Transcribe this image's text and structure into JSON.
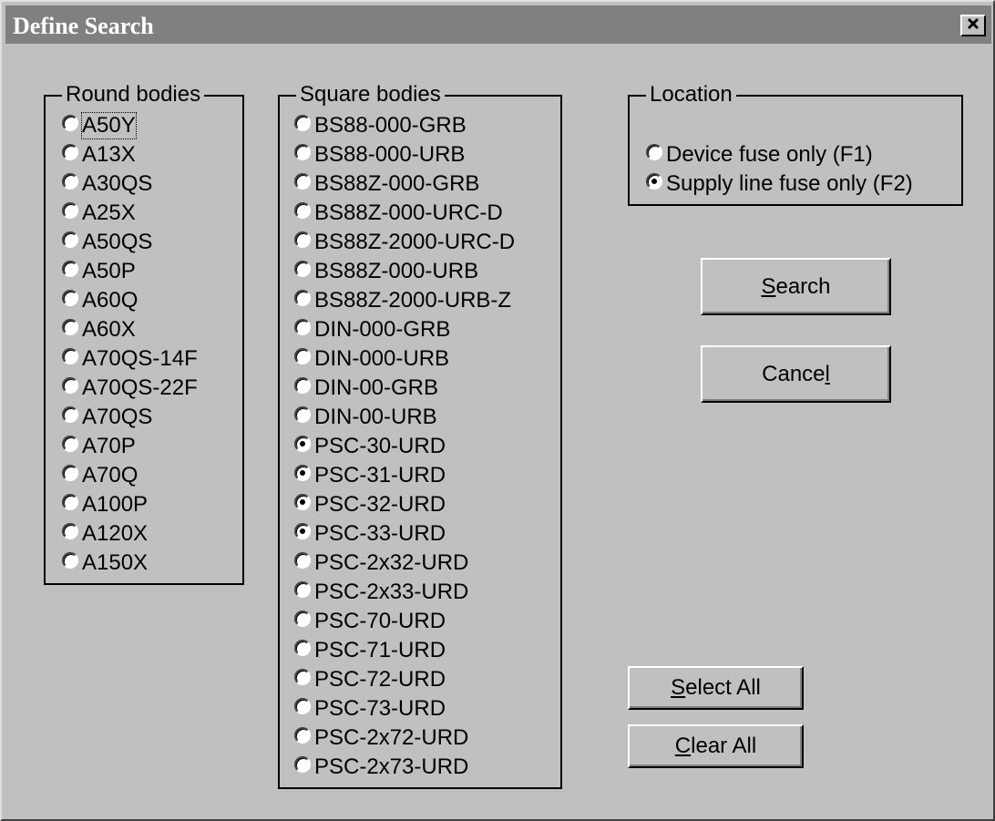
{
  "window": {
    "title": "Define Search",
    "close_icon": "close-x-icon"
  },
  "round_bodies": {
    "legend": "Round bodies",
    "items": [
      {
        "label": "A50Y",
        "checked": false,
        "focused": true
      },
      {
        "label": "A13X",
        "checked": false
      },
      {
        "label": "A30QS",
        "checked": false
      },
      {
        "label": "A25X",
        "checked": false
      },
      {
        "label": "A50QS",
        "checked": false
      },
      {
        "label": "A50P",
        "checked": false
      },
      {
        "label": "A60Q",
        "checked": false
      },
      {
        "label": "A60X",
        "checked": false
      },
      {
        "label": "A70QS-14F",
        "checked": false
      },
      {
        "label": "A70QS-22F",
        "checked": false
      },
      {
        "label": "A70QS",
        "checked": false
      },
      {
        "label": "A70P",
        "checked": false
      },
      {
        "label": "A70Q",
        "checked": false
      },
      {
        "label": "A100P",
        "checked": false
      },
      {
        "label": "A120X",
        "checked": false
      },
      {
        "label": "A150X",
        "checked": false
      }
    ]
  },
  "square_bodies": {
    "legend": "Square bodies",
    "items": [
      {
        "label": "BS88-000-GRB",
        "checked": false
      },
      {
        "label": "BS88-000-URB",
        "checked": false
      },
      {
        "label": "BS88Z-000-GRB",
        "checked": false
      },
      {
        "label": "BS88Z-000-URC-D",
        "checked": false
      },
      {
        "label": "BS88Z-2000-URC-D",
        "checked": false
      },
      {
        "label": "BS88Z-000-URB",
        "checked": false
      },
      {
        "label": "BS88Z-2000-URB-Z",
        "checked": false
      },
      {
        "label": "DIN-000-GRB",
        "checked": false
      },
      {
        "label": "DIN-000-URB",
        "checked": false
      },
      {
        "label": "DIN-00-GRB",
        "checked": false
      },
      {
        "label": "DIN-00-URB",
        "checked": false
      },
      {
        "label": "PSC-30-URD",
        "checked": true
      },
      {
        "label": "PSC-31-URD",
        "checked": true
      },
      {
        "label": "PSC-32-URD",
        "checked": true
      },
      {
        "label": "PSC-33-URD",
        "checked": true
      },
      {
        "label": "PSC-2x32-URD",
        "checked": false
      },
      {
        "label": "PSC-2x33-URD",
        "checked": false
      },
      {
        "label": "PSC-70-URD",
        "checked": false
      },
      {
        "label": "PSC-71-URD",
        "checked": false
      },
      {
        "label": "PSC-72-URD",
        "checked": false
      },
      {
        "label": "PSC-73-URD",
        "checked": false
      },
      {
        "label": "PSC-2x72-URD",
        "checked": false
      },
      {
        "label": "PSC-2x73-URD",
        "checked": false
      }
    ]
  },
  "location": {
    "legend": "Location",
    "items": [
      {
        "label": "Device fuse only (F1)",
        "checked": false
      },
      {
        "label": "Supply line fuse only (F2)",
        "checked": true
      }
    ]
  },
  "buttons": {
    "search": {
      "mnemonic": "S",
      "rest": "earch"
    },
    "cancel": {
      "pre": "Cance",
      "mnemonic": "l",
      "rest": ""
    },
    "select_all": {
      "mnemonic": "S",
      "rest": "elect All"
    },
    "clear_all": {
      "mnemonic": "C",
      "rest": "lear All"
    }
  }
}
